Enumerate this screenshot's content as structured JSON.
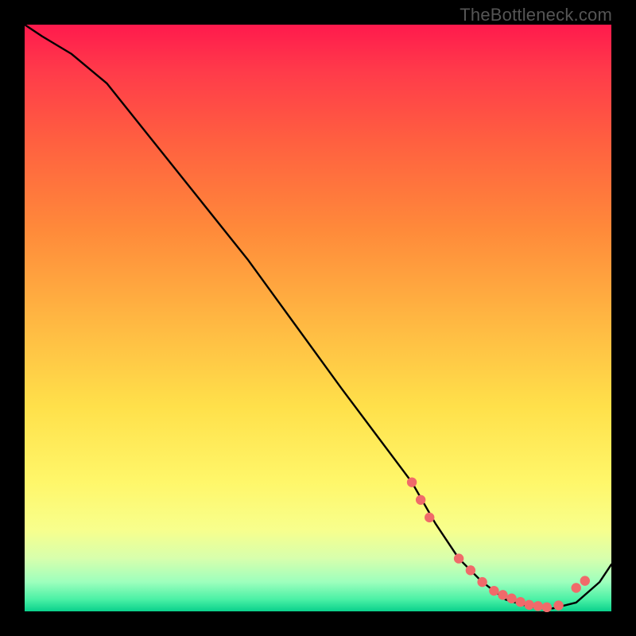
{
  "attribution": "TheBottleneck.com",
  "colors": {
    "bg": "#000000",
    "curve": "#000000",
    "dot_fill": "#f06a6a",
    "dot_stroke": "#c73f3f"
  },
  "chart_data": {
    "type": "line",
    "title": "",
    "xlabel": "",
    "ylabel": "",
    "xlim": [
      0,
      100
    ],
    "ylim": [
      0,
      100
    ],
    "series": [
      {
        "name": "curve",
        "x": [
          0,
          3,
          8,
          14,
          22,
          30,
          38,
          46,
          54,
          60,
          66,
          70,
          74,
          78,
          82,
          86,
          90,
          94,
          98,
          100
        ],
        "y": [
          100,
          98,
          95,
          90,
          80,
          70,
          60,
          49,
          38,
          30,
          22,
          15,
          9,
          5,
          2,
          0.8,
          0.5,
          1.5,
          5,
          8
        ]
      }
    ],
    "dots": {
      "name": "markers",
      "x": [
        66,
        67.5,
        69,
        74,
        76,
        78,
        80,
        81.5,
        83,
        84.5,
        86,
        87.5,
        89,
        91,
        94,
        95.5
      ],
      "y": [
        22,
        19,
        16,
        9,
        7,
        5,
        3.5,
        2.8,
        2.2,
        1.6,
        1.1,
        0.9,
        0.7,
        1.0,
        4.0,
        5.2
      ]
    }
  }
}
